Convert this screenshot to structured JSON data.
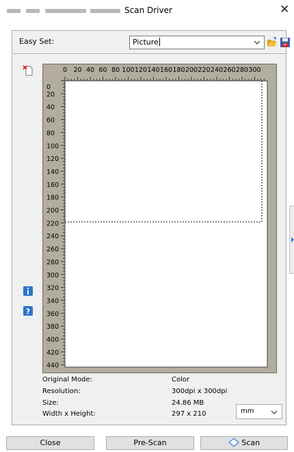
{
  "window": {
    "title": "Scan Driver"
  },
  "easy_set": {
    "label": "Easy Set:",
    "value": "Picture"
  },
  "ruler": {
    "top_ticks": [
      "0",
      "20",
      "40",
      "60",
      "80",
      "100",
      "120",
      "140",
      "160",
      "180",
      "200",
      "220",
      "240",
      "260",
      "280",
      "300"
    ],
    "left_ticks": [
      "0",
      "20",
      "40",
      "60",
      "80",
      "100",
      "120",
      "140",
      "160",
      "180",
      "200",
      "220",
      "240",
      "260",
      "280",
      "300",
      "320",
      "340",
      "360",
      "380",
      "400",
      "420",
      "440"
    ]
  },
  "info": {
    "original_mode": {
      "label": "Original Mode:",
      "value": "Color"
    },
    "resolution": {
      "label": "Resolution:",
      "value": "300dpi x 300dpi"
    },
    "size": {
      "label": "Size:",
      "value": "24.86 MB"
    },
    "width_height": {
      "label": "Width x Height:",
      "value": "297 x 210"
    }
  },
  "unit": {
    "value": "mm"
  },
  "buttons": {
    "close": "Close",
    "prescan": "Pre-Scan",
    "scan": "Scan"
  },
  "colors": {
    "frame_bg": "#b2ad9f",
    "accent": "#3b7bd6",
    "folder": "#e9b42c"
  }
}
